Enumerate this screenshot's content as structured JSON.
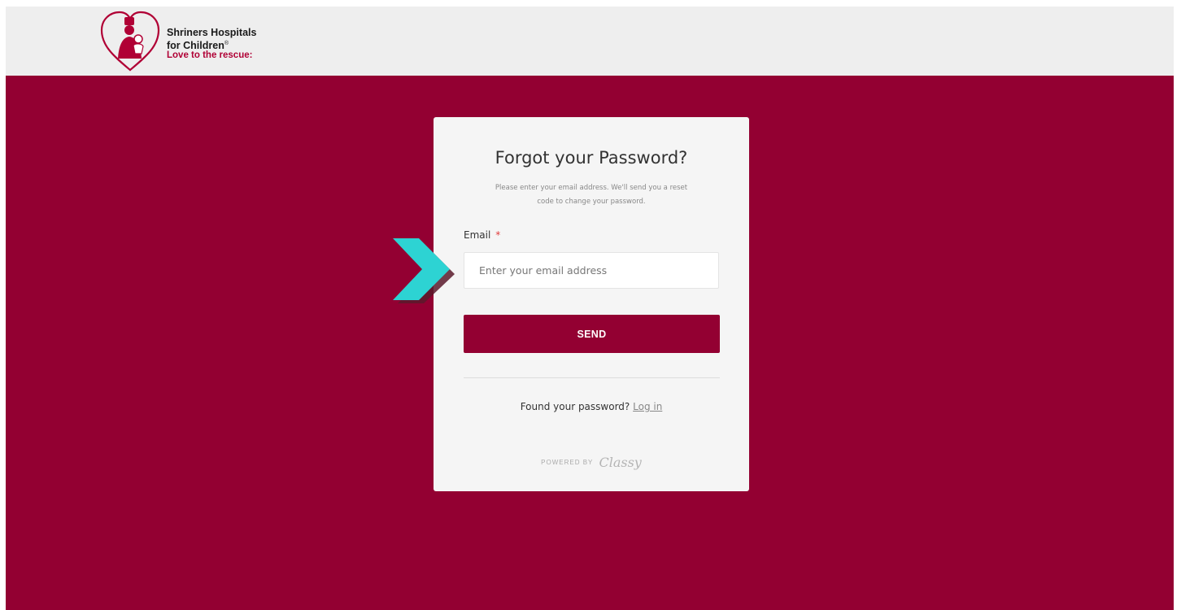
{
  "header": {
    "logo": {
      "line1": "Shriners Hospitals",
      "line2": "for Children",
      "registered": "®",
      "tagline": "Love to the rescue",
      "tagline_mark": ":"
    }
  },
  "card": {
    "title": "Forgot your Password?",
    "subtitle_line1": "Please enter your email address. We'll send you a reset",
    "subtitle_line2": "code to change your password.",
    "email_label": "Email",
    "required_mark": "*",
    "email_placeholder": "Enter your email address",
    "email_value": "",
    "send_label": "SEND",
    "found_text": "Found your password?",
    "login_link": "Log in",
    "powered_by": "POWERED BY",
    "powered_brand": "Classy"
  },
  "colors": {
    "brand": "#930032",
    "header_bg": "#eeeeee",
    "card_bg": "#f5f5f5",
    "required": "#e03a3a",
    "pointer_arrow": "#2dd3d3"
  },
  "icons": {
    "logo_mark": "heart-with-figure-icon",
    "pointer": "chevron-right-icon"
  }
}
